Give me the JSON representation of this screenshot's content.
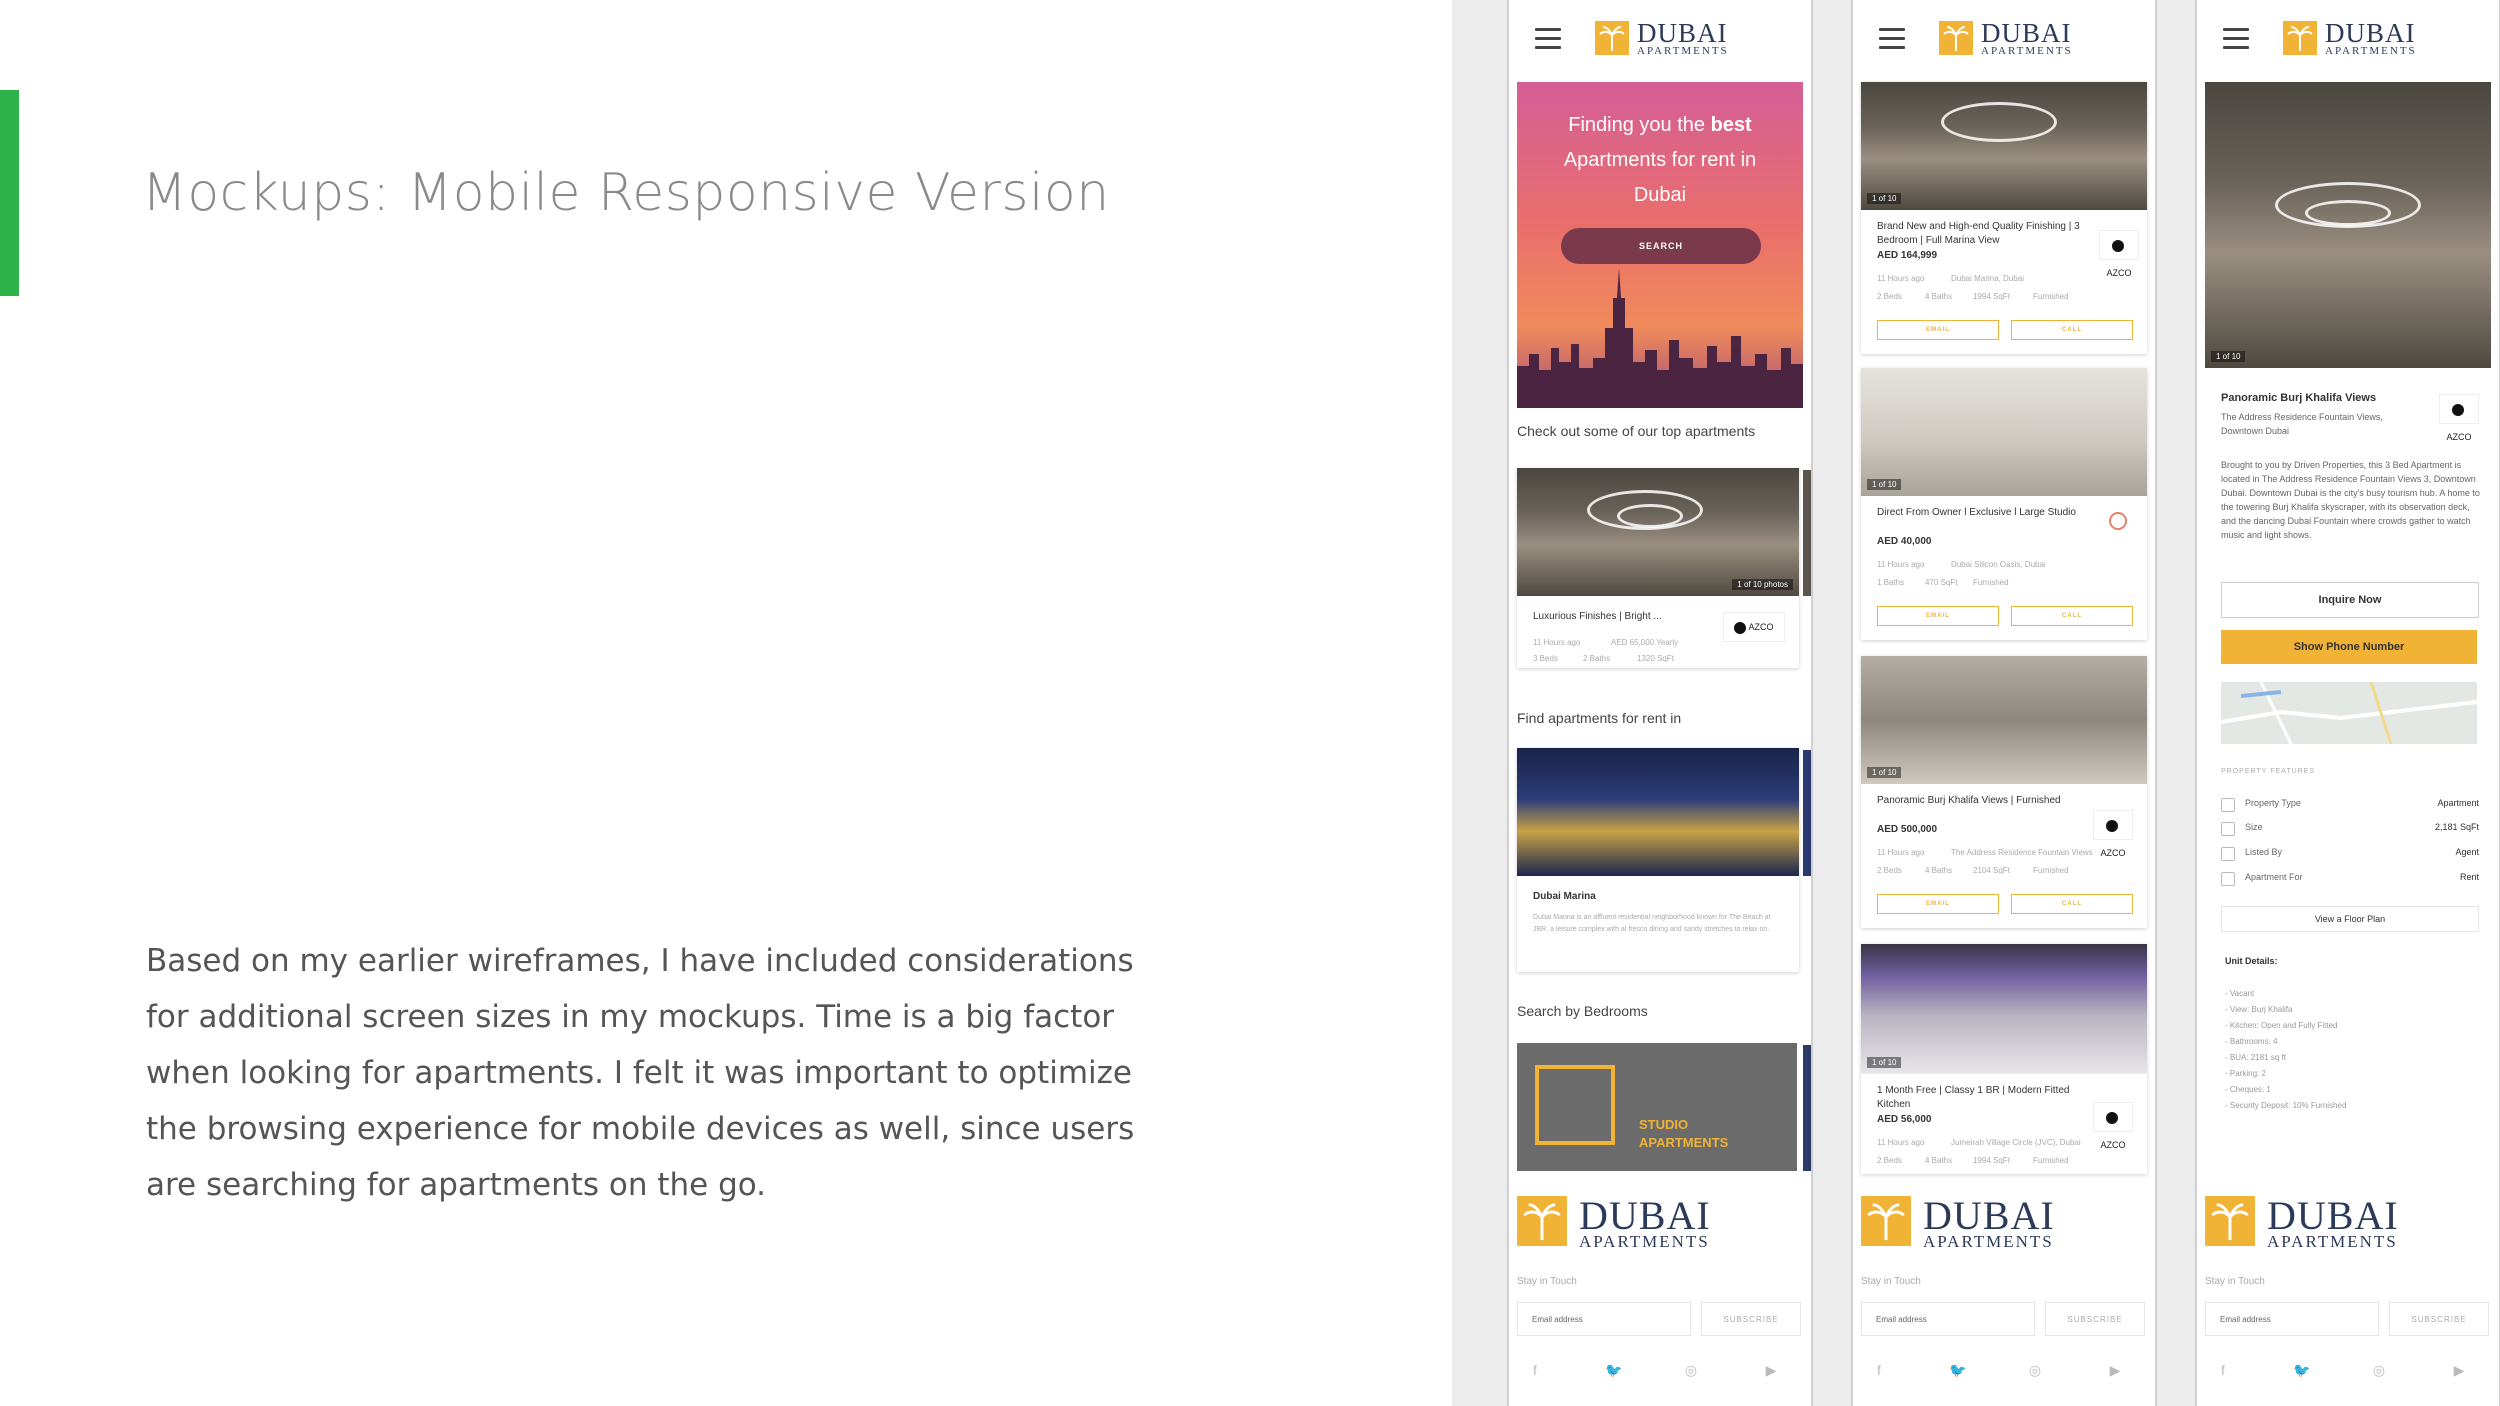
{
  "slide": {
    "title": "Mockups: Mobile Responsive Version",
    "body": "Based on my earlier wireframes, I have included considerations for additional screen sizes in my mockups. Time is a big factor when looking for apartments. I felt it was important to optimize the browsing experience for mobile devices as well, since users are searching for apartments on the go.",
    "accent_color": "#2db34a"
  },
  "brand": {
    "name": "DUBAI",
    "sub": "APARTMENTS",
    "accent_color": "#f0b336"
  },
  "home": {
    "hero_pre": "Finding you the ",
    "hero_bold": "best",
    "hero_rest": "Apartments for rent in Dubai",
    "search_label": "SEARCH",
    "top_label": "Check out some of our top apartments",
    "top_card": {
      "counter": "1 of 10 photos",
      "title": "Luxurious Finishes | Bright ...",
      "meta1": "11 Hours ago",
      "price": "AED 65,000 Yearly",
      "beds": "3 Beds",
      "baths": "2 Baths",
      "size": "1320 SqFt",
      "agency": "AZCO"
    },
    "find_label": "Find apartments for rent in",
    "area": {
      "name": "Dubai Marina",
      "desc": "Dubai Marina is an affluent residential neighborhood known for The Beach at JBR, a leisure complex with al fresco dining and sandy stretches to relax on."
    },
    "bedrooms_label": "Search by Bedrooms",
    "studio_line1": "STUDIO",
    "studio_line2": "APARTMENTS"
  },
  "listings": [
    {
      "counter": "1 of 10",
      "title": "Brand New and High-end Quality Finishing | 3 Bedroom | Full Marina View",
      "price": "AED 164,999",
      "time": "11 Hours ago",
      "location": "Dubai Marina, Dubai",
      "beds": "2 Beds",
      "baths": "4 Baths",
      "size": "1994 SqFt",
      "furnished": "Furnished",
      "agency": "AZCO",
      "email_label": "EMAIL",
      "call_label": "CALL"
    },
    {
      "counter": "1 of 10",
      "title": "Direct From Owner l Exclusive l Large Studio",
      "price": "AED 40,000",
      "time": "11 Hours ago",
      "location": "Dubai Silicon Oasis, Dubai",
      "beds": "1 Baths",
      "baths": "470 SqFt",
      "size": "Furnished",
      "furnished": "",
      "agency": "",
      "email_label": "EMAIL",
      "call_label": "CALL"
    },
    {
      "counter": "1 of 10",
      "title": "Panoramic Burj Khalifa Views | Furnished",
      "price": "AED 500,000",
      "time": "11 Hours ago",
      "location": "The Address Residence Fountain Views",
      "beds": "2 Beds",
      "baths": "4 Baths",
      "size": "2104 SqFt",
      "furnished": "Furnished",
      "agency": "AZCO",
      "email_label": "EMAIL",
      "call_label": "CALL"
    },
    {
      "counter": "1 of 10",
      "title": "1 Month Free | Classy 1 BR | Modern Fitted Kitchen",
      "price": "AED 56,000",
      "time": "11 Hours ago",
      "location": "Jumeirah Village Circle (JVC), Dubai",
      "beds": "2 Beds",
      "baths": "4 Baths",
      "size": "1994 SqFt",
      "furnished": "Furnished",
      "agency": "AZCO"
    }
  ],
  "detail": {
    "counter": "1 of 10",
    "title": "Panoramic Burj Khalifa Views",
    "subtitle": "The Address Residence Fountain Views, Downtown Dubai",
    "agency": "AZCO",
    "description": "Brought to you by Driven Properties, this 3 Bed Apartment is located in The Address Residence Fountain Views 3, Downtown Dubai. Downtown Dubai is the city's busy tourism hub. A home to the towering Burj Khalifa skyscraper, with its observation deck, and the dancing Dubai Fountain where crowds gather to watch music and light shows.",
    "inquire_label": "Inquire Now",
    "phone_label": "Show Phone Number",
    "features_label": "PROPERTY FEATURES",
    "features": [
      {
        "label": "Property Type",
        "value": "Apartment"
      },
      {
        "label": "Size",
        "value": "2,181 SqFt"
      },
      {
        "label": "Listed By",
        "value": "Agent"
      },
      {
        "label": "Apartment For",
        "value": "Rent"
      }
    ],
    "floor_plan_label": "View a Floor Plan",
    "unit_details_label": "Unit Details:",
    "unit_details": [
      "- Vacant",
      "- View: Burj Khalifa",
      "- Kitchen: Open and Fully Fitted",
      "- Bathrooms: 4",
      "- BUA: 2181 sq ft",
      "- Parking: 2",
      "- Cheques: 1",
      "- Security Deposit: 10% Furnished"
    ]
  },
  "footer": {
    "stay_label": "Stay in Touch",
    "email_placeholder": "Email address",
    "subscribe_label": "SUBSCRIBE"
  }
}
